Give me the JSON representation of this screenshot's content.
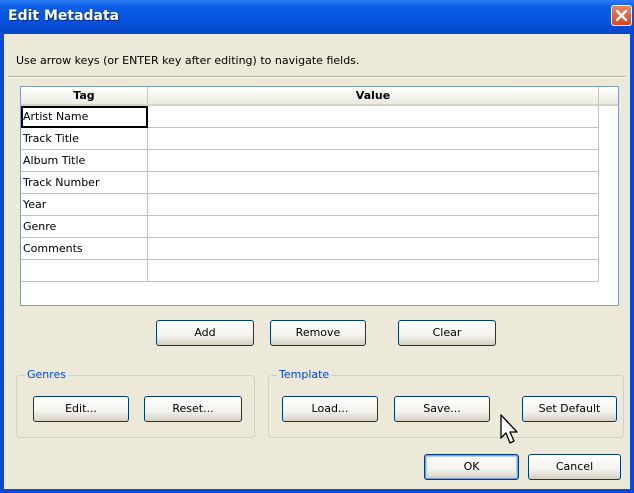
{
  "window": {
    "title": "Edit Metadata",
    "close_icon": "close-x-icon"
  },
  "instruction": "Use arrow keys (or ENTER key after editing) to navigate fields.",
  "grid": {
    "columns": [
      "Tag",
      "Value"
    ],
    "rows": [
      {
        "tag": "Artist Name",
        "value": ""
      },
      {
        "tag": "Track Title",
        "value": ""
      },
      {
        "tag": "Album Title",
        "value": ""
      },
      {
        "tag": "Track Number",
        "value": ""
      },
      {
        "tag": "Year",
        "value": ""
      },
      {
        "tag": "Genre",
        "value": ""
      },
      {
        "tag": "Comments",
        "value": ""
      },
      {
        "tag": "",
        "value": ""
      }
    ]
  },
  "row_buttons": {
    "add": "Add",
    "remove": "Remove",
    "clear": "Clear"
  },
  "genres": {
    "label": "Genres",
    "edit": "Edit...",
    "reset": "Reset..."
  },
  "template": {
    "label": "Template",
    "load": "Load...",
    "save": "Save...",
    "set_default": "Set Default"
  },
  "dialog_buttons": {
    "ok": "OK",
    "cancel": "Cancel"
  },
  "colors": {
    "title_bar": "#0553df",
    "group_label": "#0046d5",
    "dialog_bg": "#ece9d8"
  }
}
